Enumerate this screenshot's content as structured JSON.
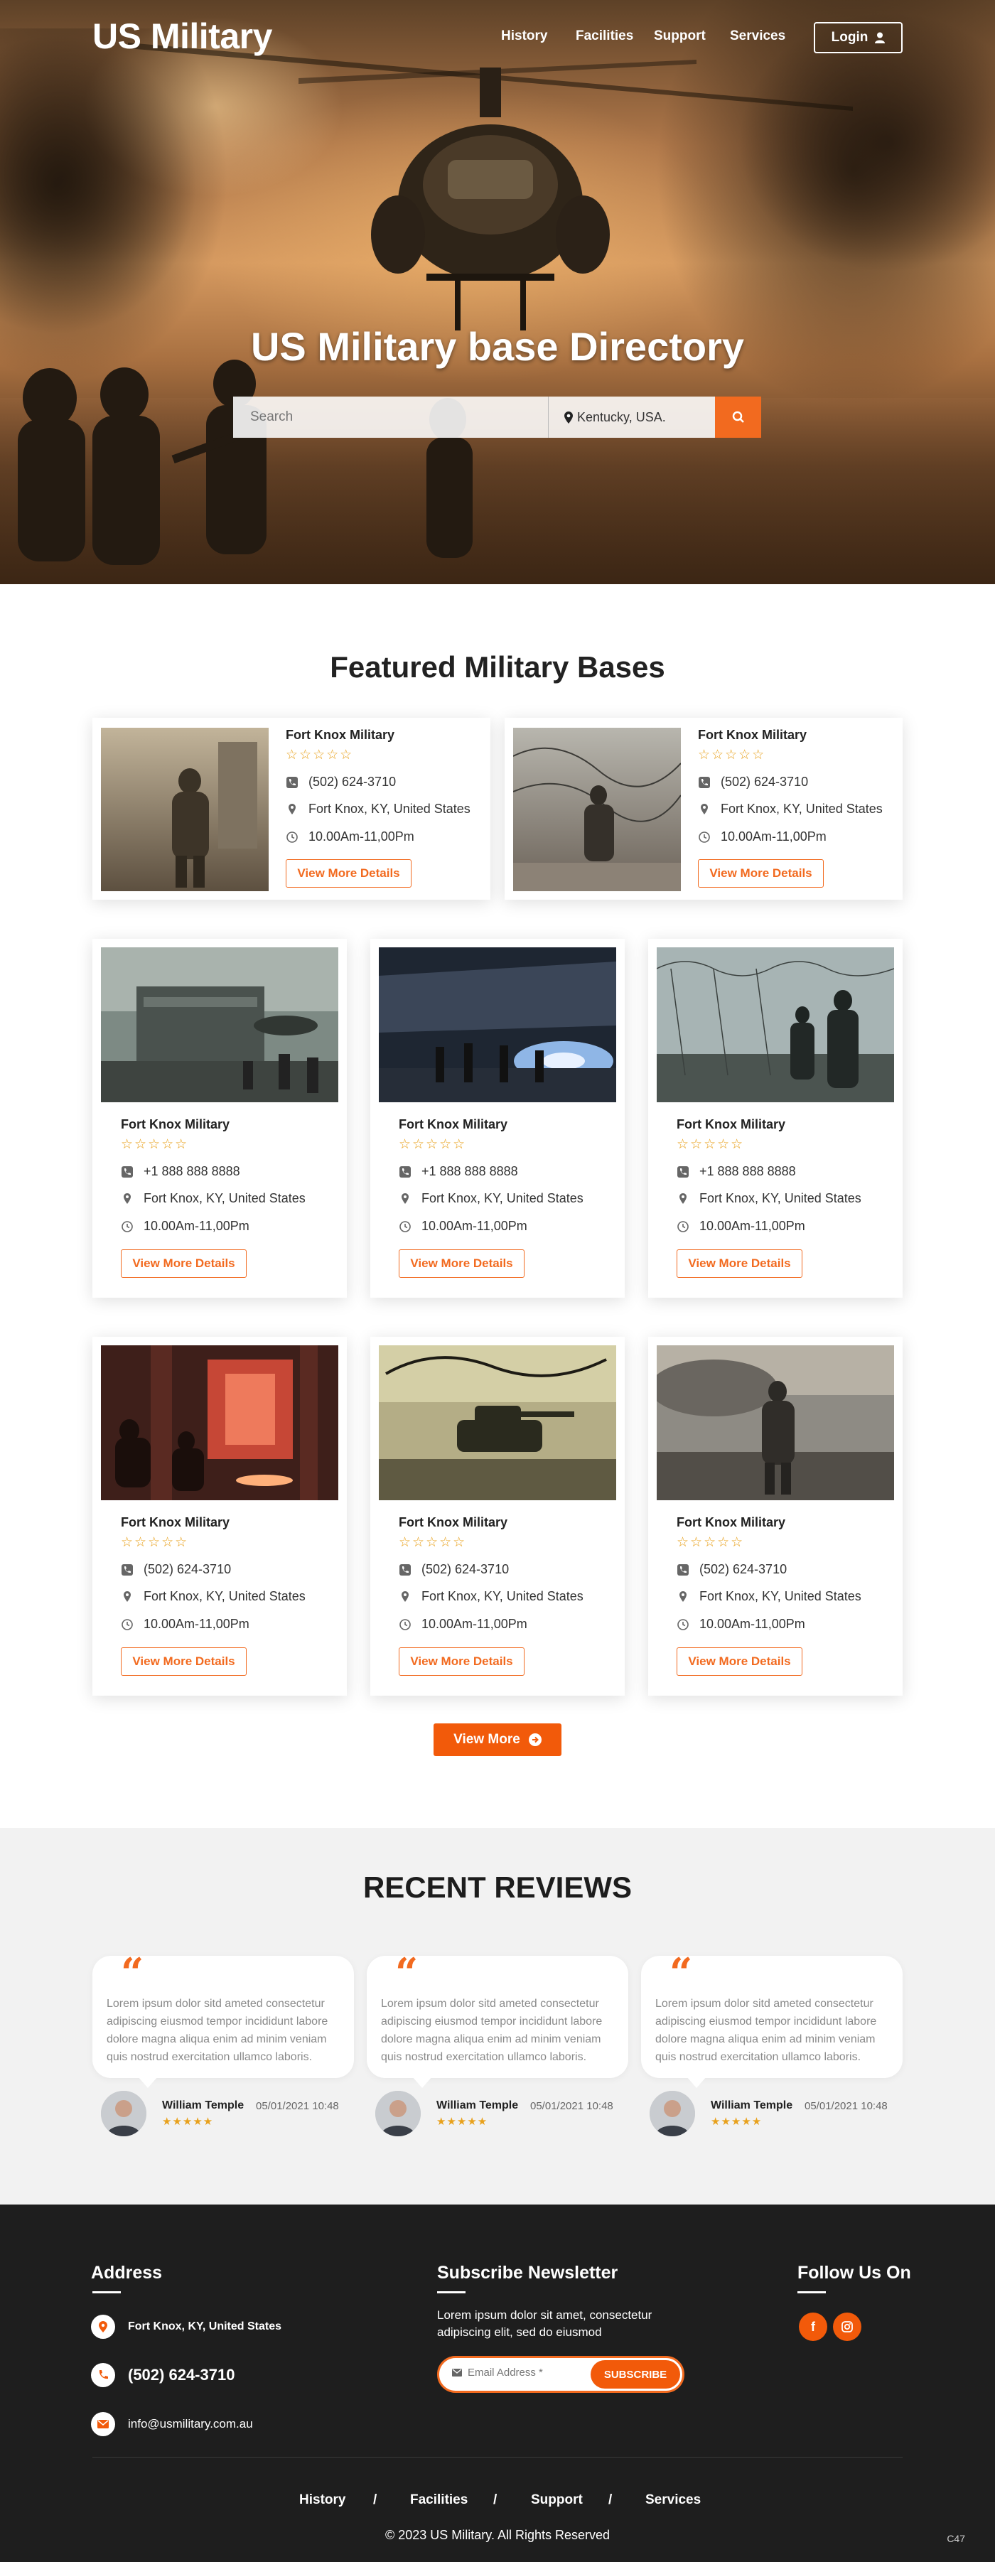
{
  "brand": {
    "logo": "US Military",
    "accent": "#f26a1f"
  },
  "nav": {
    "items": [
      "History",
      "Facilities",
      "Support",
      "Services"
    ],
    "login_label": "Login"
  },
  "hero": {
    "title": "US Military base Directory",
    "search_placeholder": "Search",
    "location_value": "Kentucky, USA."
  },
  "featured": {
    "title": "Featured Military Bases",
    "details_label": "View More Details",
    "view_more_label": "View More",
    "cards": [
      {
        "name": "Fort Knox Military",
        "rating": "☆☆☆☆☆",
        "phone": "(502) 624-3710",
        "address": "Fort Knox, KY, United States",
        "hours": "10.00Am-11,00Pm"
      },
      {
        "name": "Fort Knox Military",
        "rating": "☆☆☆☆☆",
        "phone": "(502) 624-3710",
        "address": "Fort Knox, KY, United States",
        "hours": "10.00Am-11,00Pm"
      },
      {
        "name": "Fort Knox Military",
        "rating": "☆☆☆☆☆",
        "phone": "+1 888 888 8888",
        "address": "Fort Knox, KY, United States",
        "hours": "10.00Am-11,00Pm"
      },
      {
        "name": "Fort Knox Military",
        "rating": "☆☆☆☆☆",
        "phone": "+1 888 888 8888",
        "address": "Fort Knox, KY, United States",
        "hours": "10.00Am-11,00Pm"
      },
      {
        "name": "Fort Knox Military",
        "rating": "☆☆☆☆☆",
        "phone": "+1 888 888 8888",
        "address": "Fort Knox, KY, United States",
        "hours": "10.00Am-11,00Pm"
      },
      {
        "name": "Fort Knox Military",
        "rating": "☆☆☆☆☆",
        "phone": "(502) 624-3710",
        "address": "Fort Knox, KY, United States",
        "hours": "10.00Am-11,00Pm"
      },
      {
        "name": "Fort Knox Military",
        "rating": "☆☆☆☆☆",
        "phone": "(502) 624-3710",
        "address": "Fort Knox, KY, United States",
        "hours": "10.00Am-11,00Pm"
      },
      {
        "name": "Fort Knox Military",
        "rating": "☆☆☆☆☆",
        "phone": "(502) 624-3710",
        "address": "Fort Knox, KY, United States",
        "hours": "10.00Am-11,00Pm"
      }
    ]
  },
  "reviews": {
    "title": "RECENT REVIEWS",
    "items": [
      {
        "text": "Lorem ipsum dolor sitd ameted consectetur adipiscing eiusmod tempor incididunt labore dolore magna aliqua enim ad minim veniam quis nostrud exercitation ullamco laboris.",
        "author": "William Temple",
        "date": "05/01/2021 10:48",
        "rating": "★★★★★"
      },
      {
        "text": "Lorem ipsum dolor sitd ameted consectetur adipiscing eiusmod tempor incididunt labore dolore magna aliqua enim ad minim veniam quis nostrud exercitation ullamco laboris.",
        "author": "William Temple",
        "date": "05/01/2021 10:48",
        "rating": "★★★★★"
      },
      {
        "text": "Lorem ipsum dolor sitd ameted consectetur adipiscing eiusmod tempor incididunt labore dolore magna aliqua enim ad minim veniam quis nostrud exercitation ullamco laboris.",
        "author": "William Temple",
        "date": "05/01/2021 10:48",
        "rating": "★★★★★"
      }
    ]
  },
  "footer": {
    "address_title": "Address",
    "address": "Fort Knox, KY, United States",
    "phone": "(502) 624-3710",
    "email": "info@usmilitary.com.au",
    "newsletter_title": "Subscribe Newsletter",
    "newsletter_text_1": "Lorem ipsum dolor sit amet, consectetur",
    "newsletter_text_2": "adipiscing elit, sed do eiusmod",
    "email_placeholder": "Email Address *",
    "subscribe_label": "SUBSCRIBE",
    "follow_title": "Follow Us On",
    "social_facebook": "f",
    "links": [
      "History",
      "Facilities",
      "Support",
      "Services"
    ],
    "separator": "/",
    "copyright": "© 2023  US Military. All Rights Reserved",
    "version": "C47"
  }
}
